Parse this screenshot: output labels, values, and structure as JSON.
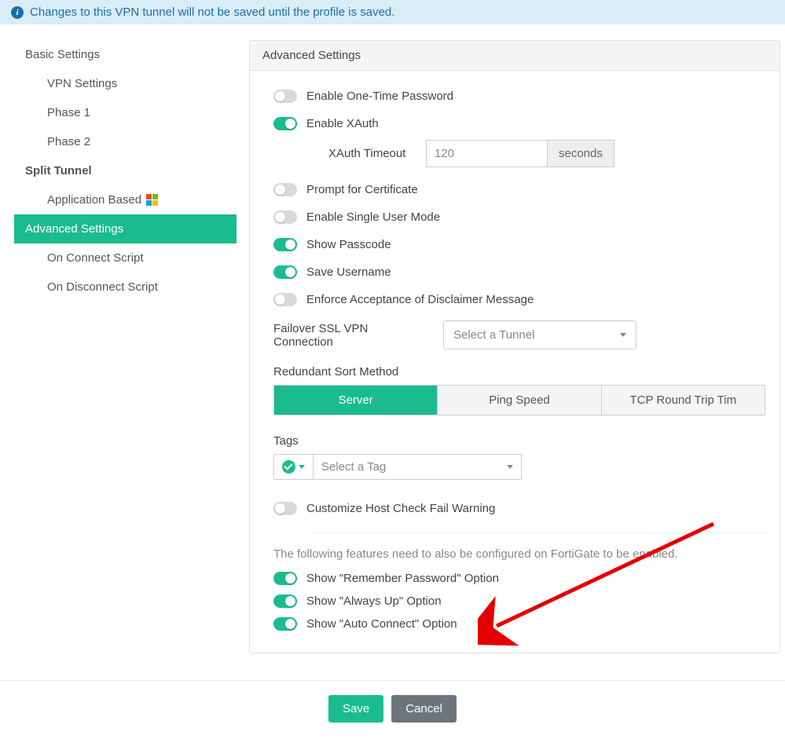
{
  "banner": "Changes to this VPN tunnel will not be saved until the profile is saved.",
  "nav": {
    "group_basic": "Basic Settings",
    "vpn_settings": "VPN Settings",
    "phase1": "Phase 1",
    "phase2": "Phase 2",
    "group_split": "Split Tunnel",
    "app_based": "Application Based",
    "advanced": "Advanced Settings",
    "on_connect": "On Connect Script",
    "on_disconnect": "On Disconnect Script"
  },
  "panel": {
    "title": "Advanced Settings",
    "toggles": {
      "otp": "Enable One-Time Password",
      "xauth": "Enable XAuth",
      "xauth_timeout_label": "XAuth Timeout",
      "xauth_timeout_value": "120",
      "xauth_timeout_unit": "seconds",
      "prompt_cert": "Prompt for Certificate",
      "single_user": "Enable Single User Mode",
      "show_passcode": "Show Passcode",
      "save_username": "Save Username",
      "disclaimer": "Enforce Acceptance of Disclaimer Message"
    },
    "failover_label": "Failover SSL VPN Connection",
    "failover_placeholder": "Select a Tunnel",
    "redundant_label": "Redundant Sort Method",
    "redundant_options": {
      "server": "Server",
      "ping": "Ping Speed",
      "tcp": "TCP Round Trip Tim"
    },
    "tags_label": "Tags",
    "tags_placeholder": "Select a Tag",
    "custom_hostcheck": "Customize Host Check Fail Warning",
    "hint": "The following features need to also be configured on FortiGate to be enabled.",
    "fg": {
      "remember": "Show \"Remember Password\" Option",
      "alwaysup": "Show \"Always Up\" Option",
      "autoconnect": "Show \"Auto Connect\" Option"
    }
  },
  "footer": {
    "save": "Save",
    "cancel": "Cancel"
  }
}
